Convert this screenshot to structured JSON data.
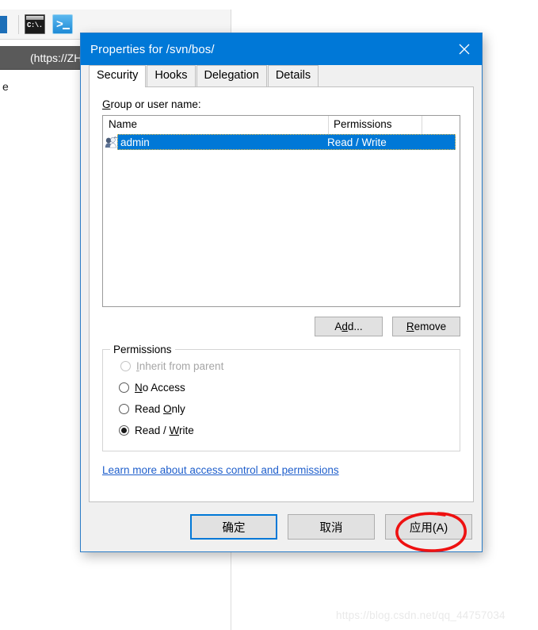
{
  "background": {
    "toolbar": {
      "icons": [
        {
          "name": "cmd-icon",
          "label": "C:\\."
        },
        {
          "name": "powershell-icon",
          "label": ">_"
        }
      ]
    },
    "address_bar": {
      "text": "(https://ZHEN"
    },
    "content_text": "e"
  },
  "dialog": {
    "title": "Properties for /svn/bos/",
    "close_label": "✕",
    "accent_color": "#0078d7",
    "tabs": [
      {
        "label": "Security",
        "active": true
      },
      {
        "label": "Hooks",
        "active": false
      },
      {
        "label": "Delegation",
        "active": false
      },
      {
        "label": "Details",
        "active": false
      }
    ],
    "security": {
      "group_label_pre": "G",
      "group_label_rest": "roup or user name:",
      "list": {
        "columns": [
          "Name",
          "Permissions"
        ],
        "rows": [
          {
            "icon": "users-group-icon",
            "name": "admin",
            "permissions": "Read / Write",
            "selected": true
          }
        ]
      },
      "buttons": {
        "add": {
          "pre": "A",
          "mnemonic": "d",
          "post": "d..."
        },
        "remove": {
          "mnemonic": "R",
          "post": "emove"
        }
      },
      "permissions": {
        "title": "Permissions",
        "options": [
          {
            "mnemonic": "I",
            "post": "nherit from parent",
            "selected": false,
            "disabled": true
          },
          {
            "mnemonic": "N",
            "post": "o Access",
            "selected": false,
            "disabled": false
          },
          {
            "pre": "Read ",
            "mnemonic": "O",
            "post": "nly",
            "selected": false,
            "disabled": false
          },
          {
            "pre": "Read / ",
            "mnemonic": "W",
            "post": "rite",
            "selected": true,
            "disabled": false
          }
        ]
      },
      "help_link": "Learn more about access control and permissions"
    },
    "footer_buttons": [
      {
        "label": "确定",
        "default": true
      },
      {
        "label": "取消",
        "default": false
      },
      {
        "label": "应用(A)",
        "default": false,
        "mnemonic_underline": "A",
        "annotated": true
      }
    ]
  },
  "annotations": {
    "color": "#ee1111",
    "marks": [
      {
        "name": "underline-admin-row",
        "shape": "line"
      },
      {
        "name": "underline-read-write",
        "shape": "curve"
      },
      {
        "name": "circle-apply-button",
        "shape": "ellipse"
      }
    ]
  },
  "watermark": "https://blog.csdn.net/qq_44757034"
}
